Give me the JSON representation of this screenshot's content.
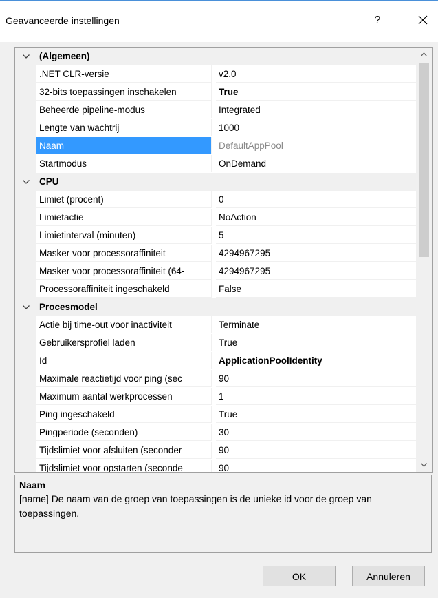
{
  "window": {
    "title": "Geavanceerde instellingen",
    "help": "?",
    "close_icon": "close-icon"
  },
  "grid": {
    "categories": [
      {
        "label": "(Algemeen)",
        "props": [
          {
            "name": ".NET CLR-versie",
            "value": "v2.0"
          },
          {
            "name": "32-bits toepassingen inschakelen",
            "value": "True",
            "bold": true
          },
          {
            "name": "Beheerde pipeline-modus",
            "value": "Integrated"
          },
          {
            "name": "Lengte van wachtrij",
            "value": "1000"
          },
          {
            "name": "Naam",
            "value": "DefaultAppPool",
            "selected": true
          },
          {
            "name": "Startmodus",
            "value": "OnDemand"
          }
        ]
      },
      {
        "label": "CPU",
        "props": [
          {
            "name": "Limiet (procent)",
            "value": "0"
          },
          {
            "name": "Limietactie",
            "value": "NoAction"
          },
          {
            "name": "Limietinterval (minuten)",
            "value": "5"
          },
          {
            "name": "Masker voor processoraffiniteit",
            "value": "4294967295"
          },
          {
            "name": "Masker voor processoraffiniteit (64-",
            "value": "4294967295"
          },
          {
            "name": "Processoraffiniteit ingeschakeld",
            "value": "False"
          }
        ]
      },
      {
        "label": "Procesmodel",
        "props": [
          {
            "name": "Actie bij time-out voor inactiviteit",
            "value": "Terminate"
          },
          {
            "name": "Gebruikersprofiel laden",
            "value": "True"
          },
          {
            "name": "Id",
            "value": "ApplicationPoolIdentity",
            "bold": true
          },
          {
            "name": "Maximale reactietijd voor ping (sec",
            "value": "90"
          },
          {
            "name": "Maximum aantal werkprocessen",
            "value": "1"
          },
          {
            "name": "Ping ingeschakeld",
            "value": "True"
          },
          {
            "name": "Pingperiode (seconden)",
            "value": "30"
          },
          {
            "name": "Tijdslimiet voor afsluiten (seconder",
            "value": "90"
          },
          {
            "name": "Tijdslimiet voor opstarten (seconde",
            "value": "90"
          }
        ]
      }
    ]
  },
  "description": {
    "title": "Naam",
    "text": "[name] De naam van de groep van toepassingen is de unieke id voor de groep van toepassingen."
  },
  "buttons": {
    "ok": "OK",
    "cancel": "Annuleren"
  }
}
